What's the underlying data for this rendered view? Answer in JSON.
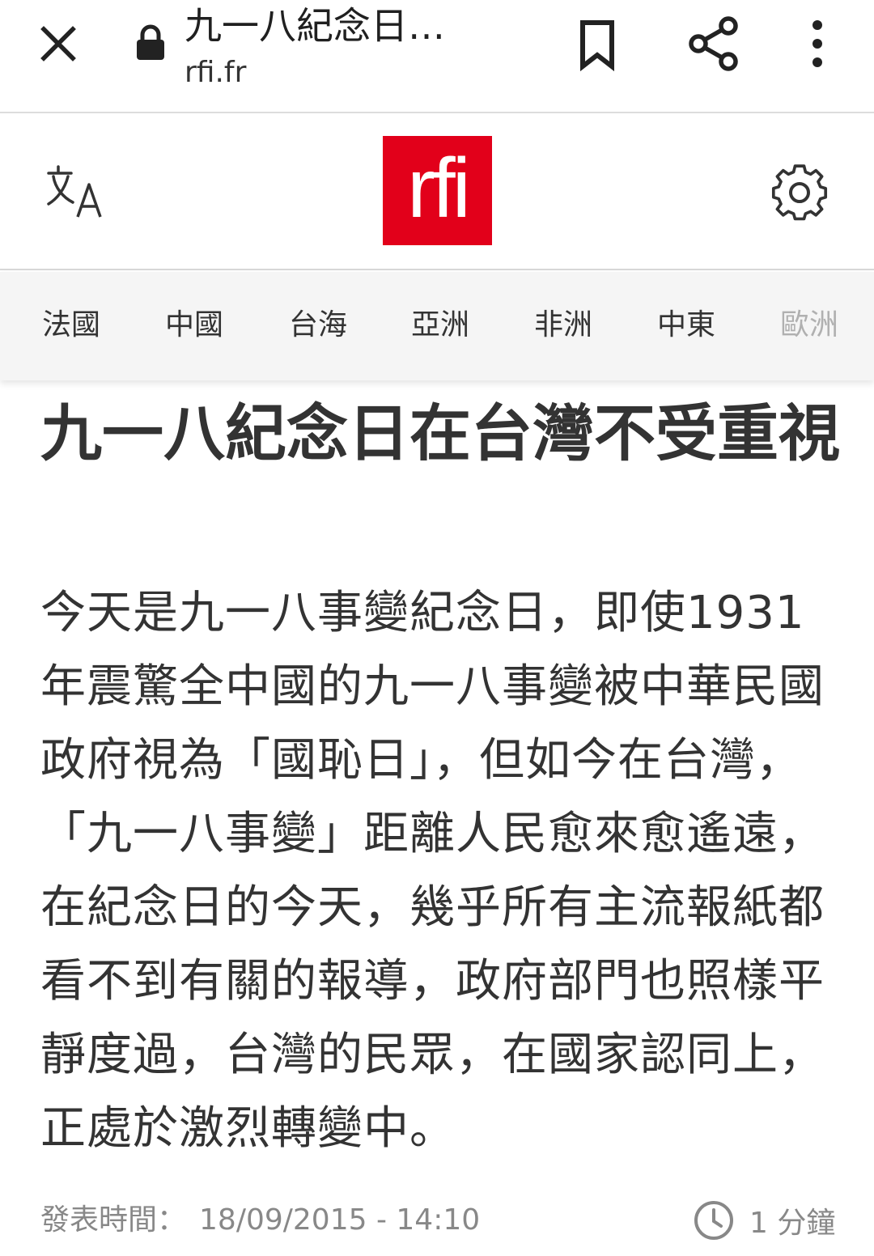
{
  "browser": {
    "page_title": "九一八紀念日…",
    "url": "rfi.fr"
  },
  "site": {
    "logo_text": "rfi",
    "brand_color": "#e2001a"
  },
  "nav": {
    "items": [
      {
        "label": "法國"
      },
      {
        "label": "中國"
      },
      {
        "label": "台海"
      },
      {
        "label": "亞洲"
      },
      {
        "label": "非洲"
      },
      {
        "label": "中東"
      },
      {
        "label": "歐洲"
      }
    ]
  },
  "article": {
    "headline": "九一八紀念日在台灣不受重視",
    "lead": "今天是九一八事變紀念日，即使1931年震驚全中國的九一八事變被中華民國政府視為「國恥日」，但如今在台灣，「九一八事變」距離人民愈來愈遙遠，在紀念日的今天，幾乎所有主流報紙都看不到有關的報導，政府部門也照樣平靜度過，台灣的民眾，在國家認同上，正處於激烈轉變中。",
    "published_label": "發表時間：",
    "published_value": "18/09/2015 - 14:10",
    "read_time": "1 分鐘"
  },
  "icons": {
    "close": "close-icon",
    "lock": "lock-icon",
    "bookmark": "bookmark-icon",
    "share": "share-icon",
    "more": "more-vert-icon",
    "translate": "translate-icon",
    "settings": "gear-icon",
    "clock": "clock-icon"
  }
}
